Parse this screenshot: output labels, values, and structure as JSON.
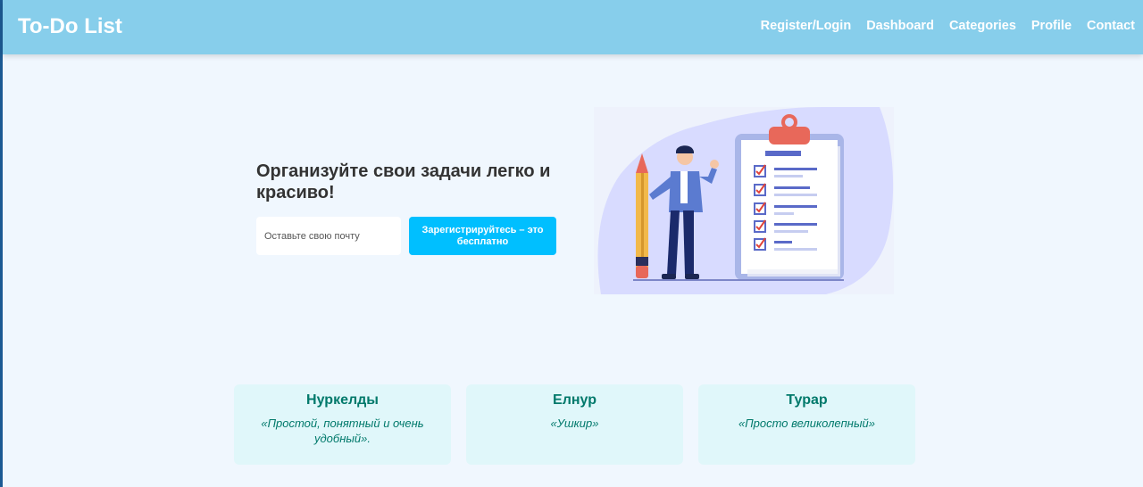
{
  "nav": {
    "brand": "To-Do List",
    "links": [
      "Register/Login",
      "Dashboard",
      "Categories",
      "Profile",
      "Contact"
    ]
  },
  "hero": {
    "title": "Организуйте свои задачи легко и красиво!",
    "email_placeholder": "Оставьте свою почту",
    "cta_label": "Зарегистрируйтесь – это бесплатно"
  },
  "illustration": {
    "icon": "person-with-pencil-and-checklist-clipboard",
    "checklist_items": 5
  },
  "testimonials": [
    {
      "name": "Нуркелды",
      "quote": "«Простой, понятный и очень удобный»."
    },
    {
      "name": "Елнур",
      "quote": "«Ушкир»"
    },
    {
      "name": "Турар",
      "quote": "«Просто великолепный»"
    }
  ],
  "colors": {
    "navbar": "#87ceeb",
    "page_bg": "#f0f7fe",
    "cta": "#00bfff",
    "card_bg": "#e0f7fa",
    "card_text": "#00796b"
  }
}
